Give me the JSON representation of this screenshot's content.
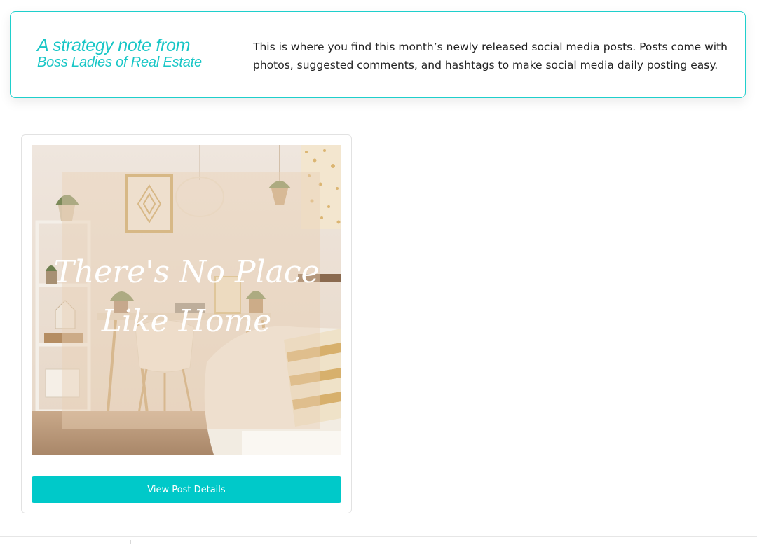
{
  "strategy_note": {
    "title_line1": "A strategy note from",
    "title_line2": "Boss Ladies of Real Estate",
    "body": "This is where you find this month’s newly released social media posts. Posts come with photos, suggested comments, and hashtags to make social media daily posting easy."
  },
  "posts": [
    {
      "image_text_line1": "There's No Place",
      "image_text_line2": "Like Home",
      "button_label": "View Post Details"
    }
  ],
  "colors": {
    "accent": "#00c9c9",
    "title": "#18c6c6",
    "border": "#1fcfcc"
  }
}
